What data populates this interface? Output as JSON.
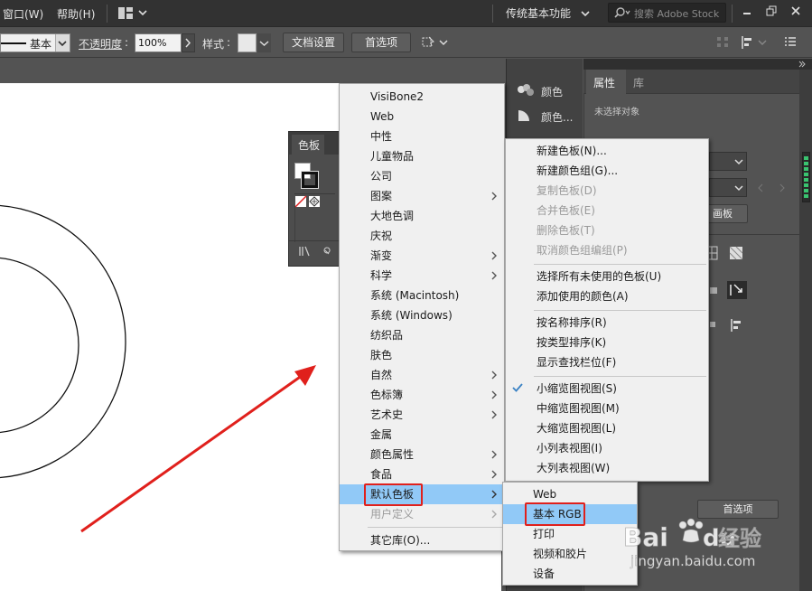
{
  "menubar": {
    "window": "窗口(W)",
    "help": "帮助(H)",
    "workspace": "传统基本功能",
    "search_placeholder": "搜索 Adobe Stock"
  },
  "control_bar": {
    "stroke_profile": "基本",
    "opacity_label": "不透明度",
    "opacity_value": "100%",
    "style_label": "样式",
    "doc_settings": "文档设置",
    "preferences": "首选项"
  },
  "dock": {
    "items": [
      "颜色",
      "颜色..."
    ]
  },
  "properties": {
    "tab_properties": "属性",
    "tab_libraries": "库",
    "no_selection": "未选择对象",
    "partial_button": "画板",
    "prefs_button": "首选项"
  },
  "swatches_panel": {
    "tab": "色板"
  },
  "library_menu": {
    "items": [
      {
        "label": "VisiBone2"
      },
      {
        "label": "Web"
      },
      {
        "label": "中性"
      },
      {
        "label": "儿童物品"
      },
      {
        "label": "公司"
      },
      {
        "label": "图案"
      },
      {
        "label": "大地色调"
      },
      {
        "label": "庆祝"
      },
      {
        "label": "渐变"
      },
      {
        "label": "科学"
      },
      {
        "label": "系统 (Macintosh)"
      },
      {
        "label": "系统 (Windows)"
      },
      {
        "label": "纺织品"
      },
      {
        "label": "肤色"
      },
      {
        "label": "自然"
      },
      {
        "label": "色标簿"
      },
      {
        "label": "艺术史"
      },
      {
        "label": "金属"
      },
      {
        "label": "颜色属性"
      },
      {
        "label": "食品"
      },
      {
        "label": "默认色板"
      },
      {
        "label": "用户定义"
      },
      {
        "label": "其它库(O)..."
      }
    ]
  },
  "panel_menu": {
    "items": [
      {
        "label": "新建色板(N)..."
      },
      {
        "label": "新建颜色组(G)..."
      },
      {
        "label": "复制色板(D)"
      },
      {
        "label": "合并色板(E)"
      },
      {
        "label": "删除色板(T)"
      },
      {
        "label": "取消颜色组编组(P)"
      },
      {
        "label": "选择所有未使用的色板(U)"
      },
      {
        "label": "添加使用的颜色(A)"
      },
      {
        "label": "按名称排序(R)"
      },
      {
        "label": "按类型排序(K)"
      },
      {
        "label": "显示查找栏位(F)"
      },
      {
        "label": "小缩览图视图(S)"
      },
      {
        "label": "中缩览图视图(M)"
      },
      {
        "label": "大缩览图视图(L)"
      },
      {
        "label": "小列表视图(I)"
      },
      {
        "label": "大列表视图(W)"
      }
    ]
  },
  "default_swatches_submenu": {
    "items": [
      {
        "label": "Web"
      },
      {
        "label": "基本 RGB"
      },
      {
        "label": "打印"
      },
      {
        "label": "视频和胶片"
      },
      {
        "label": "设备"
      }
    ]
  },
  "watermark": {
    "text": "经验",
    "url": "jingyan.baidu.com"
  },
  "colors": {
    "highlight": "#91c9f7",
    "annotation_red": "#e0201c",
    "menu_bg": "#f0f0f0",
    "ui_dark": "#323232",
    "ui_mid": "#535353"
  }
}
